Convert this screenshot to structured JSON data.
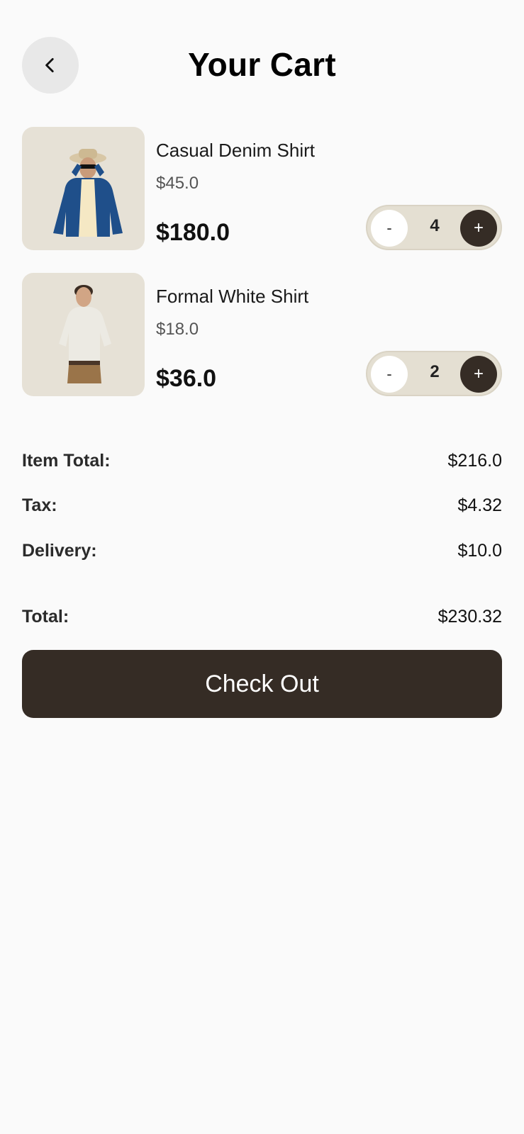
{
  "header": {
    "back_icon": "chevron-left-icon",
    "title": "Your Cart"
  },
  "cart": {
    "items": [
      {
        "name": "Casual Denim Shirt",
        "unit_price": "$45.0",
        "line_total": "$180.0",
        "quantity": "4",
        "minus_label": "-",
        "plus_label": "+"
      },
      {
        "name": "Formal White Shirt",
        "unit_price": "$18.0",
        "line_total": "$36.0",
        "quantity": "2",
        "minus_label": "-",
        "plus_label": "+"
      }
    ]
  },
  "summary": {
    "item_total_label": "Item Total:",
    "item_total_value": "$216.0",
    "tax_label": "Tax:",
    "tax_value": "$4.32",
    "delivery_label": "Delivery:",
    "delivery_value": "$10.0",
    "total_label": "Total:",
    "total_value": "$230.32"
  },
  "checkout": {
    "label": "Check Out"
  },
  "colors": {
    "background": "#fafafa",
    "accent_dark": "#352c25",
    "thumb_bg": "#e6e1d6",
    "stepper_bg": "#e4dfd2"
  }
}
